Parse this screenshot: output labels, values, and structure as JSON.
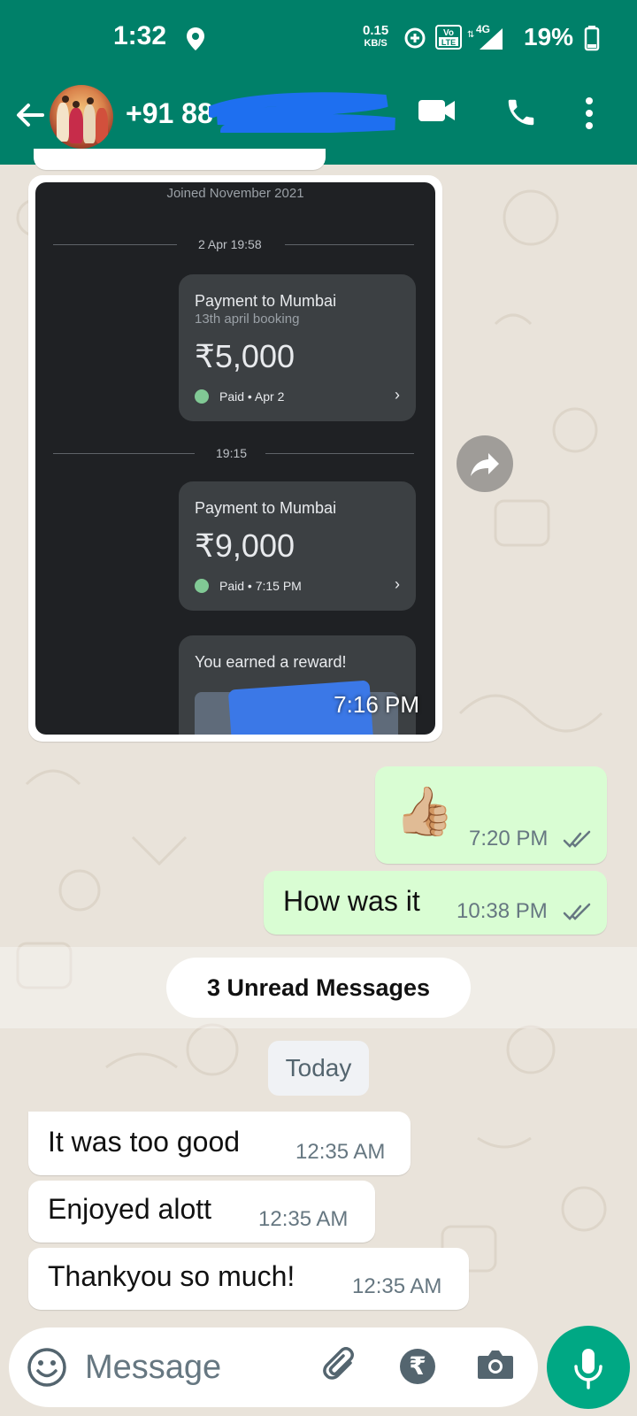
{
  "status_bar": {
    "time": "1:32",
    "net_speed_value": "0.15",
    "net_speed_unit": "KB/S",
    "volte": "Vo LTE",
    "network": "4G",
    "battery": "19%"
  },
  "header": {
    "contact_name": "+91 88",
    "accent_color": "#008069"
  },
  "messages": {
    "image_message": {
      "joined": "Joined November 2021",
      "date1": "2 Apr 19:58",
      "card1": {
        "title": "Payment to Mumbai",
        "subtitle": "13th april booking",
        "amount": "₹5,000",
        "status": "Paid • Apr 2"
      },
      "date2": "19:15",
      "card2": {
        "title": "Payment to Mumbai",
        "amount": "₹9,000",
        "status": "Paid • 7:15 PM"
      },
      "card3": {
        "title": "You earned a reward!"
      },
      "time": "7:16 PM"
    },
    "out1": {
      "emoji": "👍🏼",
      "time": "7:20 PM"
    },
    "out2": {
      "text": "How was it",
      "time": "10:38 PM"
    },
    "unread_label": "3 Unread Messages",
    "day_label": "Today",
    "in1": {
      "text": "It was too good",
      "time": "12:35 AM"
    },
    "in2": {
      "text": "Enjoyed alott",
      "time": "12:35 AM"
    },
    "in3": {
      "text": "Thankyou so much!",
      "time": "12:35 AM"
    }
  },
  "input": {
    "placeholder": "Message",
    "rupee_symbol": "₹"
  }
}
